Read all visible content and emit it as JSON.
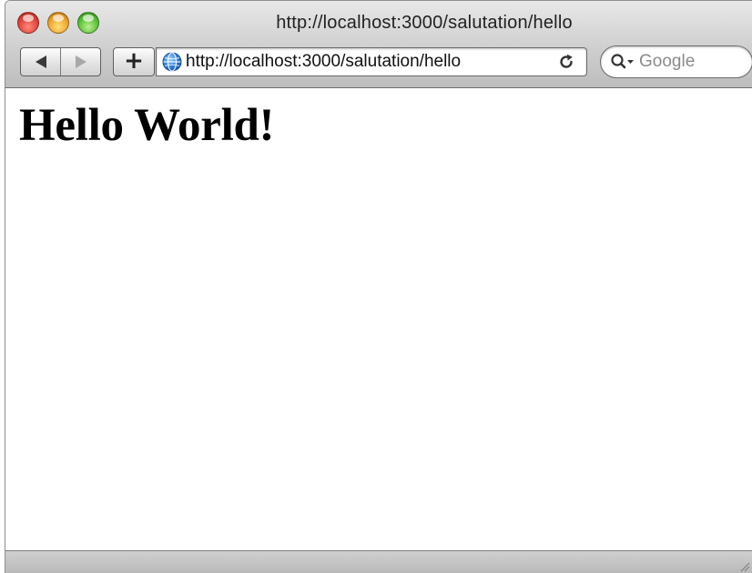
{
  "window": {
    "title": "http://localhost:3000/salutation/hello"
  },
  "toolbar": {
    "back_icon": "back-arrow-icon",
    "forward_icon": "forward-arrow-icon",
    "add_bookmark_icon": "plus-icon",
    "add_bookmark_label": "+",
    "address": {
      "site_icon": "globe-icon",
      "url": "http://localhost:3000/salutation/hello",
      "reload_icon": "reload-icon"
    },
    "search": {
      "icon": "search-icon",
      "placeholder": "Google"
    }
  },
  "page": {
    "heading": "Hello World!"
  },
  "colors": {
    "close": "#e0443a",
    "minimize": "#f0a52c",
    "maximize": "#5cbf3a",
    "globe": "#2f7fd6"
  }
}
